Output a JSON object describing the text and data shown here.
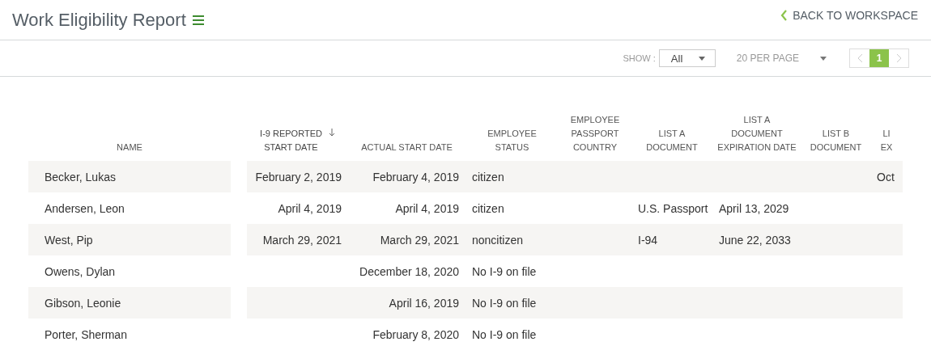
{
  "header": {
    "title": "Work Eligibility Report",
    "back_link": "BACK TO WORKSPACE"
  },
  "toolbar": {
    "show_label": "SHOW :",
    "show_value": "All",
    "per_page": "20 PER PAGE",
    "pages": [
      {
        "label": "1",
        "selected": true
      }
    ]
  },
  "table": {
    "columns": [
      {
        "heading": [
          "NAME"
        ],
        "sorted": false
      },
      {
        "heading": [
          "I-9 REPORTED",
          "START DATE"
        ],
        "sorted": true
      },
      {
        "heading": [
          "ACTUAL START DATE"
        ],
        "sorted": false
      },
      {
        "heading": [
          "EMPLOYEE",
          "STATUS"
        ],
        "sorted": false
      },
      {
        "heading": [
          "EMPLOYEE",
          "PASSPORT",
          "COUNTRY"
        ],
        "sorted": false
      },
      {
        "heading": [
          "LIST A",
          "DOCUMENT"
        ],
        "sorted": false
      },
      {
        "heading": [
          "LIST A",
          "DOCUMENT",
          "EXPIRATION DATE"
        ],
        "sorted": false
      },
      {
        "heading": [
          "LIST B",
          "DOCUMENT"
        ],
        "sorted": false
      },
      {
        "heading": [
          "LI",
          "EX"
        ],
        "sorted": false
      }
    ],
    "rows": [
      [
        "Becker, Lukas",
        "February 2, 2019",
        "February 4, 2019",
        "citizen",
        "",
        "",
        "",
        "",
        "Oct"
      ],
      [
        "Andersen, Leon",
        "April 4, 2019",
        "April 4, 2019",
        "citizen",
        "",
        "U.S. Passport",
        "April 13, 2029",
        "",
        ""
      ],
      [
        "West, Pip",
        "March 29, 2021",
        "March 29, 2021",
        "noncitizen",
        "",
        "I-94",
        "June 22, 2033",
        "",
        ""
      ],
      [
        "Owens, Dylan",
        "",
        "December 18, 2020",
        "No I-9 on file",
        "",
        "",
        "",
        "",
        ""
      ],
      [
        "Gibson, Leonie",
        "",
        "April 16, 2019",
        "No I-9 on file",
        "",
        "",
        "",
        "",
        ""
      ],
      [
        "Porter, Sherman",
        "",
        "February 8, 2020",
        "No I-9 on file",
        "",
        "",
        "",
        "",
        ""
      ]
    ]
  }
}
